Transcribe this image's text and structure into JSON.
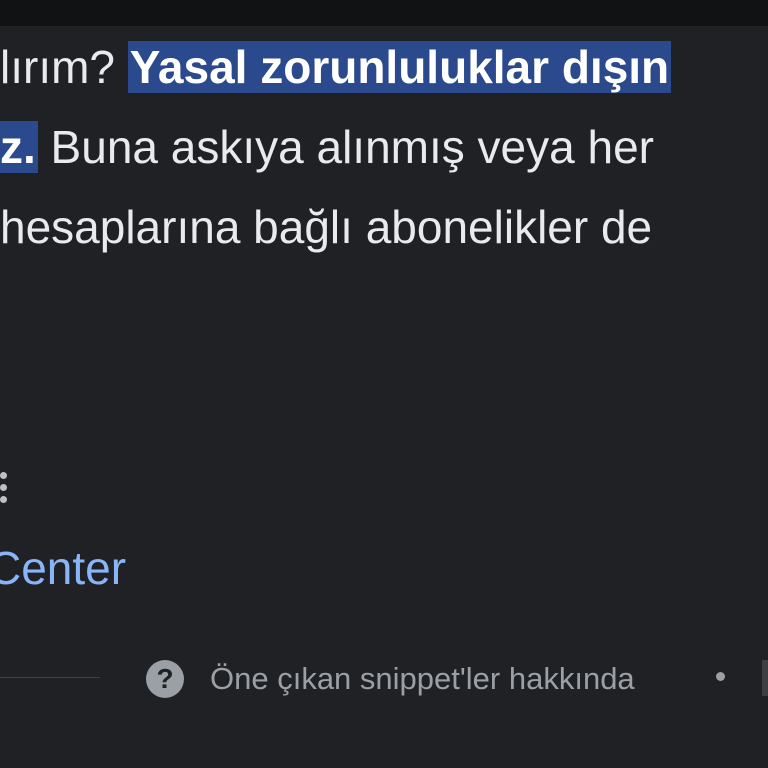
{
  "snippet": {
    "line1_plain": "lırım? ",
    "line1_highlight": "Yasal zorunluluklar dışın",
    "line2_highlight": "z.",
    "line2_plain": " Buna askıya alınmış veya her",
    "line3_plain": "hesaplarına bağlı abonelikler de"
  },
  "source": {
    "more_icon": "more-vert-icon",
    "link_text": "Center"
  },
  "footer": {
    "help_icon": "help-icon",
    "help_glyph": "?",
    "about_text": "Öne çıkan snippet'ler hakkında"
  },
  "colors": {
    "background": "#202124",
    "highlight": "#2b4a8d",
    "link": "#8ab4f8",
    "muted": "#9aa0a6"
  }
}
